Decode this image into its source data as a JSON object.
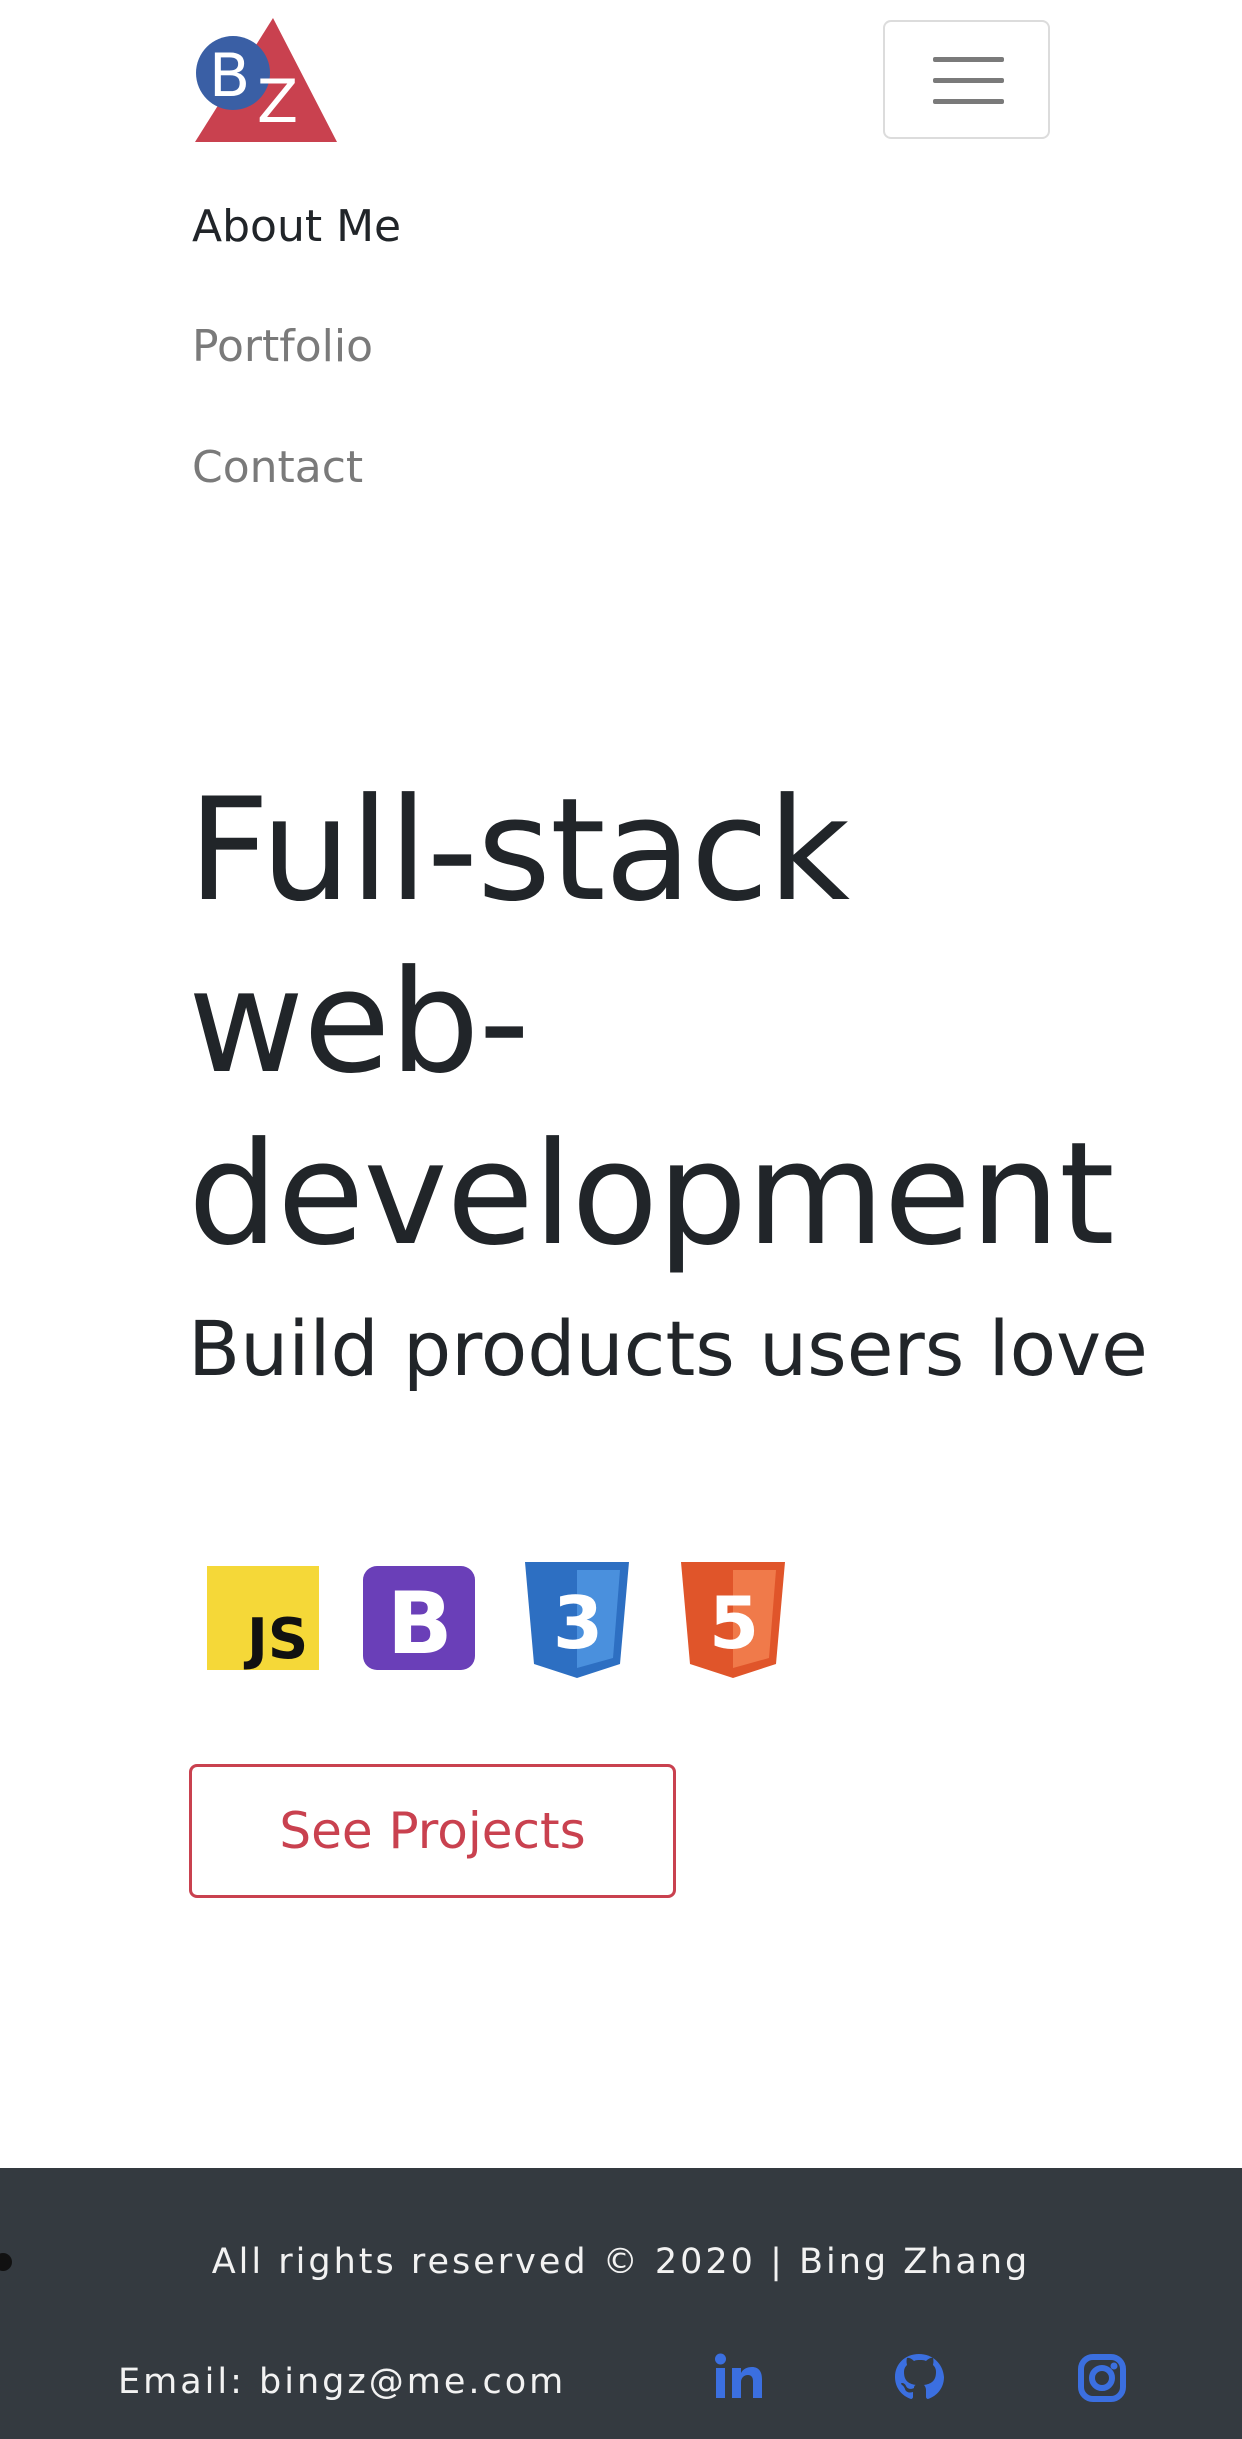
{
  "brand": {
    "logo_text": "BZ",
    "colors": {
      "triangle": "#c9414f",
      "circle": "#3a5fa5"
    }
  },
  "nav": {
    "items": [
      {
        "label": "About Me",
        "active": true
      },
      {
        "label": "Portfolio",
        "active": false
      },
      {
        "label": "Contact",
        "active": false
      }
    ],
    "toggler_icon": "hamburger-icon"
  },
  "hero": {
    "title_lines": [
      "Full-stack",
      "web-",
      "development"
    ],
    "subtitle": "Build products users love",
    "tech_icons": [
      "javascript-icon",
      "bootstrap-icon",
      "css3-icon",
      "html5-icon"
    ],
    "cta_label": "See Projects"
  },
  "footer": {
    "copyright": "All rights reserved © 2020 | Bing Zhang",
    "email": "Email: bingz@me.com",
    "social_icons": [
      "linkedin-icon",
      "github-icon",
      "instagram-icon"
    ],
    "social_color": "#3b6fe0",
    "background": "#343a40"
  },
  "accent": "#c9414f"
}
